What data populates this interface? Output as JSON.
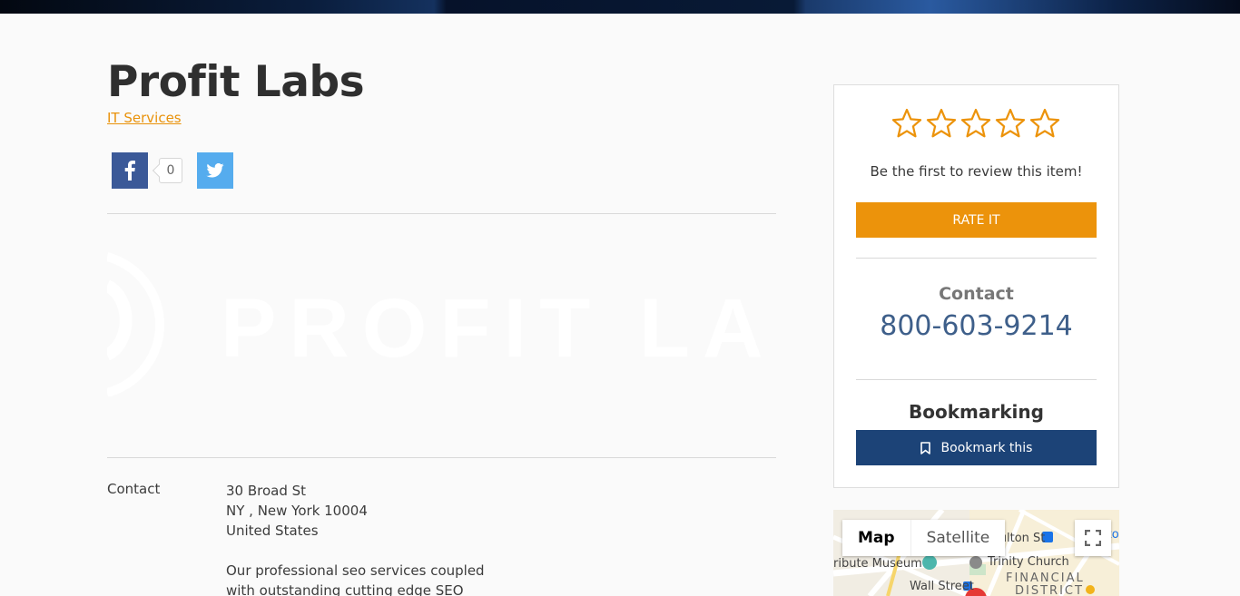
{
  "listing": {
    "title": "Profit Labs",
    "category": "IT Services"
  },
  "share": {
    "facebook_count": "0",
    "facebook_icon": "facebook-icon",
    "twitter_icon": "twitter-icon"
  },
  "logo": {
    "text": "PROFIT LAB"
  },
  "details": {
    "contact_label": "Contact",
    "address_line1": "30 Broad St",
    "address_line2": "NY , New York 10004",
    "address_line3": "United States",
    "description_line1": "Our professional seo services coupled",
    "description_line2": "with outstanding cutting edge SEO"
  },
  "sidebar": {
    "rating_stars": 0,
    "rating_max": 5,
    "review_cta": "Be the first to review this item!",
    "rate_button": "RATE IT",
    "contact_heading": "Contact",
    "phone": "800-603-9214",
    "bookmark_heading": "Bookmarking",
    "bookmark_button": "Bookmark this"
  },
  "map": {
    "tab_map": "Map",
    "tab_satellite": "Satellite",
    "labels": {
      "fulton": "Fulton St",
      "museum": "ribute Museum",
      "church": "Trinity Church",
      "financial": "FINANCIAL",
      "district": "DISTRICT",
      "wall_street": "Wall Street",
      "edge": "lto"
    }
  },
  "colors": {
    "accent": "#ec930b",
    "facebook": "#3b5998",
    "twitter": "#55acee",
    "bookmark": "#1c4377",
    "phone": "#3e5f8a"
  }
}
